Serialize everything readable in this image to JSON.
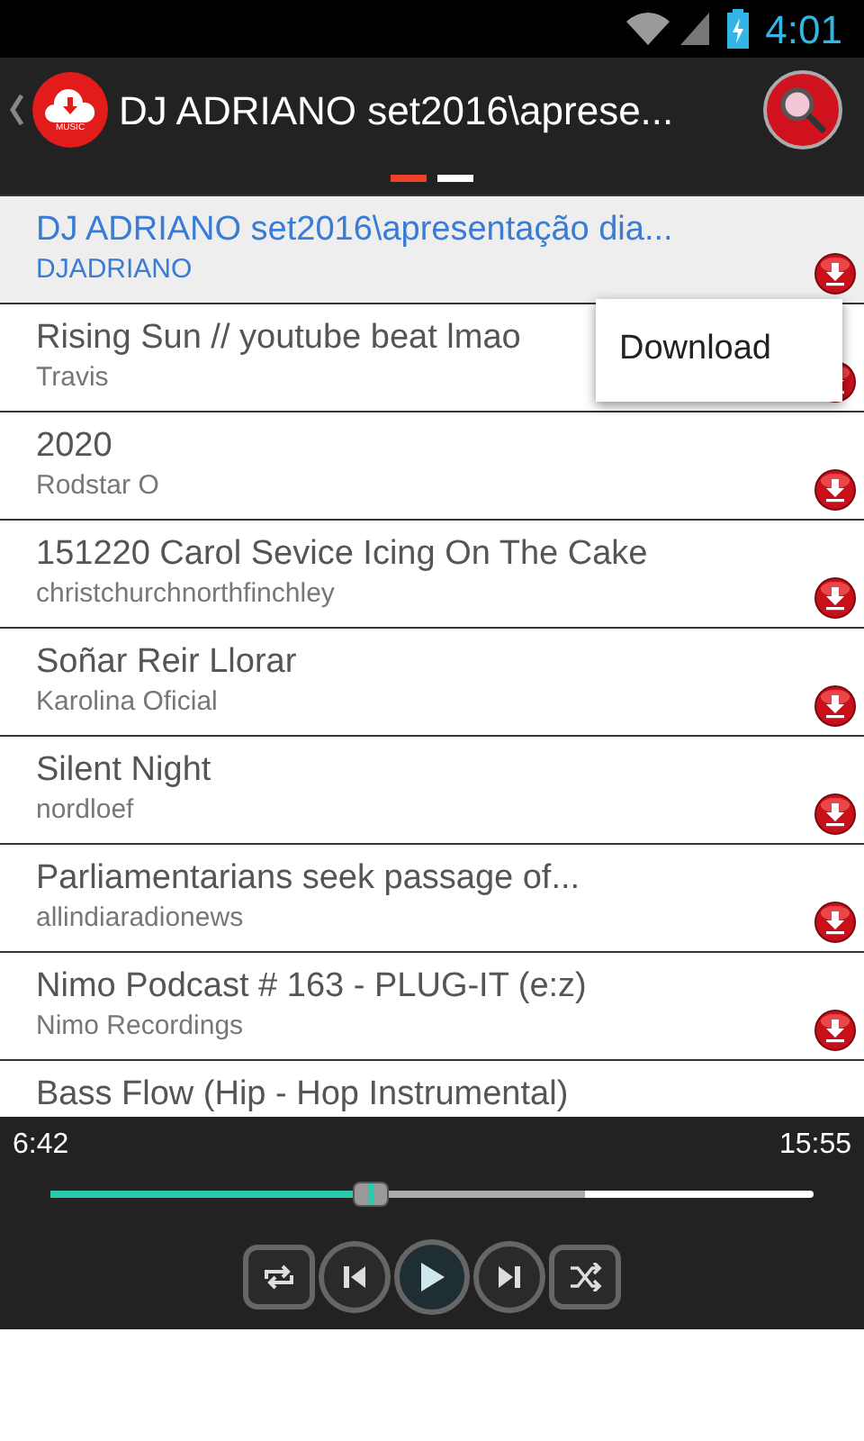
{
  "status_bar": {
    "time": "4:01"
  },
  "action_bar": {
    "logo_text": "MUSIC",
    "title": "DJ ADRIANO set2016\\aprese..."
  },
  "pages": [
    {
      "selected": true
    },
    {
      "selected": false
    }
  ],
  "tracks": [
    {
      "title": "DJ ADRIANO set2016\\apresentação dia...",
      "artist": "DJADRIANO",
      "selected": true
    },
    {
      "title": "Rising Sun // youtube beat lmao",
      "artist": "Travis",
      "selected": false
    },
    {
      "title": "2020",
      "artist": "Rodstar O",
      "selected": false
    },
    {
      "title": "151220 Carol Sevice Icing On The Cake",
      "artist": "christchurchnorthfinchley",
      "selected": false
    },
    {
      "title": "Soñar Reir Llorar",
      "artist": "Karolina Oficial",
      "selected": false
    },
    {
      "title": "Silent Night",
      "artist": "nordloef",
      "selected": false
    },
    {
      "title": "Parliamentarians seek passage of...",
      "artist": "allindiaradionews",
      "selected": false
    },
    {
      "title": "Nimo Podcast # 163 - PLUG-IT (e:z)",
      "artist": "Nimo Recordings",
      "selected": false
    },
    {
      "title": "Bass Flow (Hip - Hop Instrumental)",
      "selected": false
    }
  ],
  "popup_menu": {
    "items": [
      "Download"
    ]
  },
  "player": {
    "elapsed": "6:42",
    "duration": "15:55",
    "level": 0.42,
    "buffer": {
      "level": 0.7
    }
  }
}
